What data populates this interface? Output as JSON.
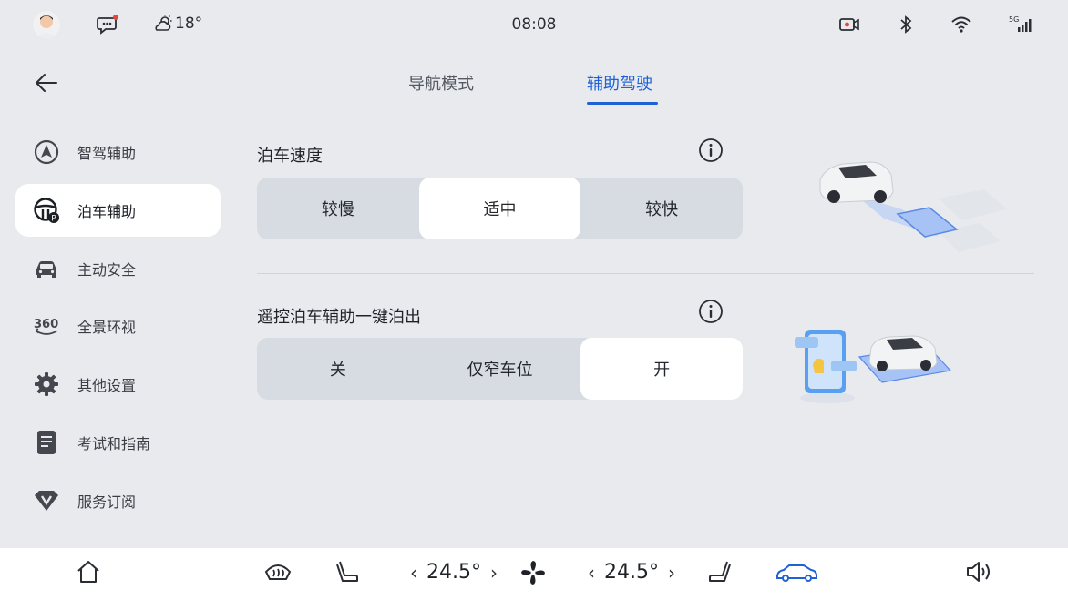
{
  "status": {
    "time": "08:08",
    "temperature": "18°",
    "signal_label": "5G"
  },
  "tabs": [
    {
      "label": "导航模式"
    },
    {
      "label": "辅助驾驶"
    }
  ],
  "sidebar": {
    "items": [
      {
        "label": "智驾辅助",
        "icon": "navigation-icon"
      },
      {
        "label": "泊车辅助",
        "icon": "steering-wheel-parking-icon"
      },
      {
        "label": "主动安全",
        "icon": "car-icon"
      },
      {
        "label": "全景环视",
        "icon": "360-view-icon"
      },
      {
        "label": "其他设置",
        "icon": "gear-icon"
      },
      {
        "label": "考试和指南",
        "icon": "document-icon"
      },
      {
        "label": "服务订阅",
        "icon": "diamond-v-icon"
      }
    ]
  },
  "parking_speed": {
    "title": "泊车速度",
    "options": [
      "较慢",
      "适中",
      "较快"
    ],
    "selected": "适中"
  },
  "remote_parking": {
    "title": "遥控泊车辅助一键泊出",
    "options": [
      "关",
      "仅窄车位",
      "开"
    ],
    "selected": "开"
  },
  "bottom_bar": {
    "left_temp": "24.5°",
    "right_temp": "24.5°"
  },
  "colors": {
    "accent": "#1f62d6",
    "background": "#e8eaee",
    "segment_bg": "#d7dbe2"
  }
}
